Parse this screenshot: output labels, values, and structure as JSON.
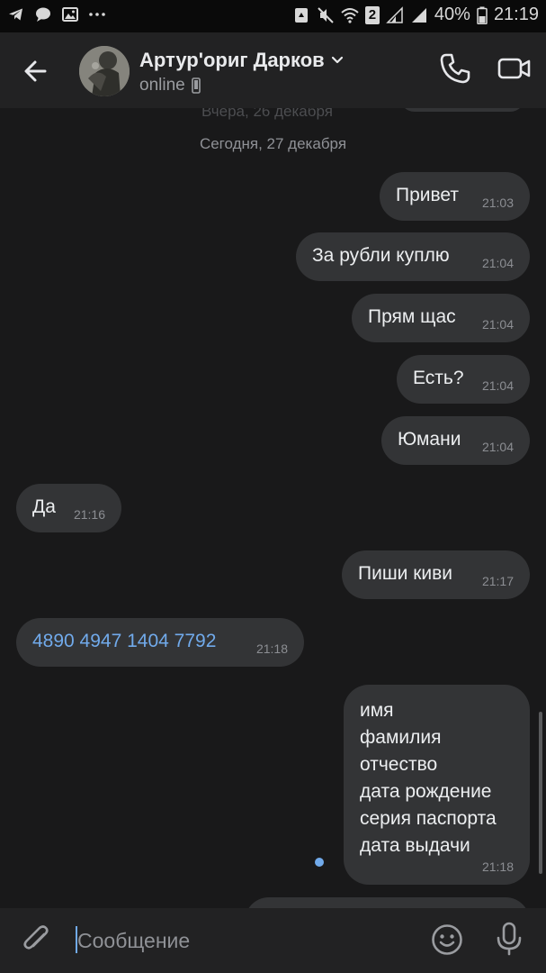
{
  "status_bar": {
    "battery_percent": "40%",
    "time": "21:19",
    "sim_badge": "2",
    "icons": [
      "telegram-icon",
      "chat-bubble-icon",
      "image-icon",
      "more-dots-icon",
      "recycle-icon",
      "mute-icon",
      "wifi-icon",
      "signal-icon",
      "signal-icon",
      "battery-icon"
    ]
  },
  "header": {
    "contact_name": "Артур'ориг Дарков",
    "status": "online",
    "icons": [
      "back-arrow-icon",
      "chevron-down-icon",
      "mobile-phone-icon",
      "phone-icon",
      "video-camera-icon"
    ]
  },
  "chat": {
    "faded_date": "Вчера, 26 декабря",
    "date_separator": "Сегодня, 27 декабря",
    "messages": [
      {
        "side": "out",
        "text": "Привет",
        "time": "21:03"
      },
      {
        "side": "out",
        "text": "За рубли куплю",
        "time": "21:04"
      },
      {
        "side": "out",
        "text": "Прям щас",
        "time": "21:04"
      },
      {
        "side": "out",
        "text": "Есть?",
        "time": "21:04"
      },
      {
        "side": "out",
        "text": "Юмани",
        "time": "21:04"
      },
      {
        "side": "in",
        "text": "Да",
        "time": "21:16"
      },
      {
        "side": "out",
        "text": "Пиши киви",
        "time": "21:17"
      },
      {
        "side": "in",
        "text": "4890 4947 1404 7792",
        "time": "21:18",
        "is_link": true
      },
      {
        "side": "out",
        "text": "имя\nфамилия\nотчество\nдата рождение\nсерия паспорта\nдата выдачи",
        "time": "21:18"
      }
    ]
  },
  "composer": {
    "placeholder": "Сообщение",
    "icons": [
      "paperclip-icon",
      "emoji-icon",
      "microphone-icon"
    ]
  },
  "colors": {
    "background": "#19191a",
    "bar": "#222223",
    "bubble": "#333436",
    "accent": "#71aaeb",
    "text": "#eceef0",
    "muted": "#8f9196"
  }
}
